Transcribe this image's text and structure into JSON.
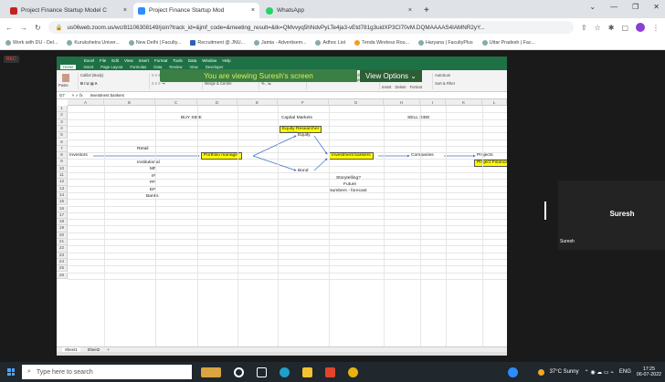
{
  "browser": {
    "tabs": [
      {
        "title": "Project Finance Startup Model C",
        "close": "×",
        "color": "#b03"
      },
      {
        "title": "Project Finance Startup Mod",
        "close": "×",
        "color": "#2d8cff"
      },
      {
        "title": "WhatsApp",
        "close": "×",
        "color": "#25d366"
      }
    ],
    "new_tab": "+",
    "url": "us06web.zoom.us/wc/81106308149/join?track_id=&jmf_code=&meeting_result=&tk=QMvvyq5hNdvPyLTe4ja3-vEtd781g3uidXP3CI70vM.DQMAAAAS4IAMNR2yY...",
    "bookmarks": [
      "Work with DU - Del...",
      "Kurukshetra Univer...",
      "New Delhi | Faculty...",
      "Recruitment @ JNU...",
      "Jamia - Advertisem...",
      "Adhoc List",
      "Tenda Wireless Rou...",
      "Haryana | FacultyPlus",
      "Uttar Pradesh | Fac..."
    ]
  },
  "zoom": {
    "rec": "REC",
    "banner": "You are viewing Suresh's screen",
    "view_options": "View Options ⌄",
    "participant_name": "Suresh",
    "participant_label": "Suresh"
  },
  "excel": {
    "title_items": [
      "Excel",
      "File",
      "Edit",
      "View",
      "Insert",
      "Format",
      "Tools",
      "Data",
      "Window",
      "Help"
    ],
    "ribbon_tabs": [
      "Home",
      "Insert",
      "Page Layout",
      "Formulas",
      "Data",
      "Review",
      "View",
      "Developer"
    ],
    "ribbon": {
      "paste": "Paste",
      "font": "Calibri (Body)",
      "general": "General",
      "wrap": "Wrap Text",
      "merge": "Merge & Centre",
      "cond": "Conditional Formatting",
      "fmt_table": "Format as Table",
      "cell_styles": "Cell Styles",
      "insert": "Insert",
      "delete": "Delete",
      "format": "Format",
      "autosum": "AutoSum",
      "sort": "Sort & Filter"
    },
    "name_box": "G7",
    "formula": "Investment bankers",
    "columns": [
      "A",
      "B",
      "C",
      "D",
      "E",
      "F",
      "G",
      "H",
      "I",
      "K",
      "L"
    ],
    "rows": [
      "1",
      "2",
      "3",
      "4",
      "5",
      "6",
      "7",
      "8",
      "9",
      "10",
      "11",
      "12",
      "13",
      "14",
      "15",
      "16",
      "17",
      "18",
      "19",
      "20",
      "21",
      "22",
      "23",
      "24",
      "25",
      "26"
    ],
    "cells": {
      "buy_side": "BUY SIDE",
      "capital_markets": "Capital Markets",
      "sell_side": "SELL SIDE",
      "equity_researcher": "Equity Researcher",
      "equity": "Equity",
      "retail": "Retail",
      "investors": "Investors",
      "portfolio_manager": "Portfolio manager",
      "investment_bankers": "Investment bankers",
      "companies": "Companies",
      "projects": "Projects",
      "project_finance": "Project Finance",
      "institutional": "Institutional",
      "mf": "MF",
      "bond": "Bond",
      "if": "IF",
      "storytelling": "Storytelling?",
      "pf": "PF",
      "future": "Future",
      "ef": "EF",
      "numbers_forecast": "Numbers - forecast",
      "banks": "Banks"
    },
    "sheets": [
      "Sheet1",
      "Sheet2",
      "+"
    ]
  },
  "taskbar": {
    "search_placeholder": "Type here to search",
    "weather": "37°C  Sunny",
    "lang": "ENG",
    "time": "17:25",
    "date": "06-07-2022"
  }
}
